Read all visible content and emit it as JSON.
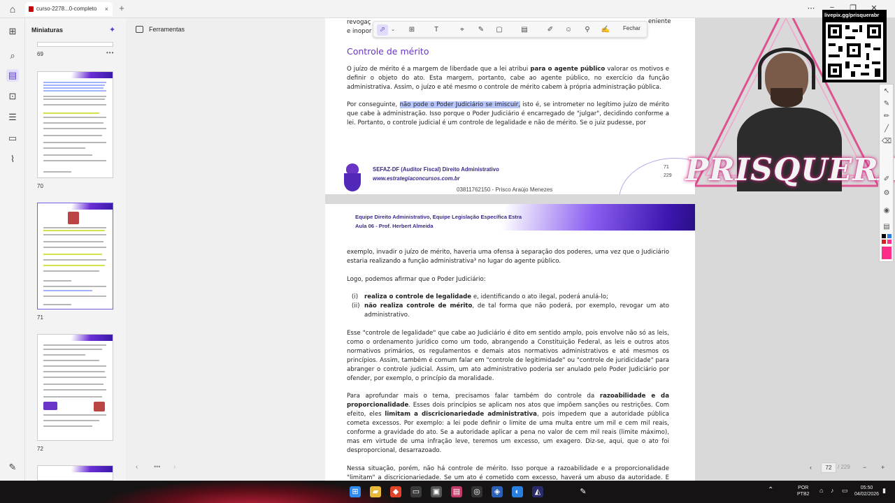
{
  "browser": {
    "tab_title": "curso-2278...0-completo",
    "close_glyph": "×",
    "new_tab_glyph": "+",
    "window_controls": [
      "✕",
      "−",
      "❐",
      "⋯"
    ]
  },
  "thumbnails_panel": {
    "title": "Miniaturas",
    "pages": [
      {
        "number": "69"
      },
      {
        "number": "70"
      },
      {
        "number": "71"
      },
      {
        "number": "72"
      }
    ],
    "more_glyph": "•••"
  },
  "tools_panel": {
    "label": "Ferramentas"
  },
  "annotation_toolbar": {
    "close_label": "Fechar",
    "icons": [
      "select-icon",
      "text-box-icon",
      "text-icon",
      "comment-icon",
      "draw-icon",
      "shape-icon",
      "highlight-icon",
      "stamp-icon",
      "signature-icon",
      "sign-icon"
    ]
  },
  "page71": {
    "top_fragment_1": "revogaç",
    "top_fragment_2": "e inopor",
    "top_fragment_3": "eniente",
    "heading": "Controle de mérito",
    "para1_a": "O juízo de mérito é a margem de liberdade que a lei atribui ",
    "para1_b": "para o agente público",
    "para1_c": " valorar os motivos e definir o objeto do ato. Esta margem, portanto, cabe ao agente público, no exercício da função administrativa. Assim, o juízo e até mesmo o controle de mérito cabem à própria administração pública.",
    "para2_a": "Por conseguinte, ",
    "para2_hl_a": "não ",
    "para2_hl_b": "pode o Poder Judiciário se imiscuir,",
    "para2_c": " isto é, se intrometer no legítimo juízo de mérito que cabe à administração. Isso porque o Poder Judiciário é encarregado de \"julgar\", decidindo conforme a lei. Portanto, o controle judicial é um controle de legalidade e não de mérito. Se o juiz pudesse, por",
    "footer_line1": "SEFAZ-DF (Auditor Fiscal) Direito Administrativo",
    "footer_line2": "www.estrategiaconcursos.com.br",
    "footer_id": "03811762150 - Prisco Araújo Menezes",
    "page_num": "71",
    "page_total": "229"
  },
  "page72": {
    "header_line1": "Equipe Direito Administrativo, Equipe Legislação Específica Estra",
    "header_line2": "Aula 06 - Prof. Herbert Almeida",
    "para1": "exemplo, invadir o juízo de mérito, haveria uma ofensa à separação dos poderes, uma vez que o Judiciário estaria realizando a função administrativa³ no lugar do agente público.",
    "para2": "Logo, podemos afirmar que o Poder Judiciário:",
    "item1_num": "(i)",
    "item1_bold": "realiza o controle de legalidade",
    "item1_rest": " e, identificando o ato ilegal, poderá anulá-lo;",
    "item2_num": "(ii)",
    "item2_bold": "não realiza controle de mérito",
    "item2_rest": ", de tal forma que não poderá, por exemplo, revogar um ato administrativo.",
    "para3": "Esse \"controle de legalidade\" que cabe ao Judiciário é dito em sentido amplo, pois envolve não só as leis, como o ordenamento jurídico como um todo, abrangendo a Constituição Federal, as leis e outros atos normativos primários, os regulamentos e demais atos normativos administrativos e até mesmos os princípios. Assim, também é comum falar em \"controle de legitimidade\" ou \"controle de juridicidade\" para abranger o controle judicial. Assim, um ato administrativo poderia ser anulado pelo Poder Judiciário por ofender, por exemplo, o princípio da moralidade.",
    "para4_a": "Para aprofundar mais o tema, precisamos falar também do controle da ",
    "para4_b": "razoabilidade e da proporcionalidade",
    "para4_c": ". Esses dois princípios se aplicam nos atos que impõem sanções ou restrições. Com efeito, eles ",
    "para4_d": "limitam a discricionariedade administrativa",
    "para4_e": ", pois impedem que a autoridade pública cometa excessos. Por exemplo: a lei pode definir o limite de uma multa entre um mil e cem mil reais, conforme a gravidade do ato. Se a autoridade aplicar a pena no valor de cem mil reais (limite máximo), mas em virtude de uma infração leve, teremos um excesso, um exagero. Diz-se, aqui, que o ato foi desproporcional, desarrazoado.",
    "para5": "Nessa situação, porém, não há controle de mérito. Isso porque a razoabilidade e a proporcionalidade \"limitam\" a discricionariedade. Se um ato é cometido com excesso, haverá um abuso da autoridade. E esse"
  },
  "overlay": {
    "qr_label": "livepix.gg/prisquerabr",
    "streamer_name": "PRISQUERA"
  },
  "page_nav": {
    "current": "72",
    "total": "/ 229"
  },
  "taskbar": {
    "lang_1": "POR",
    "lang_2": "PTB2",
    "time": "05:50",
    "date": "04/02/2026"
  }
}
